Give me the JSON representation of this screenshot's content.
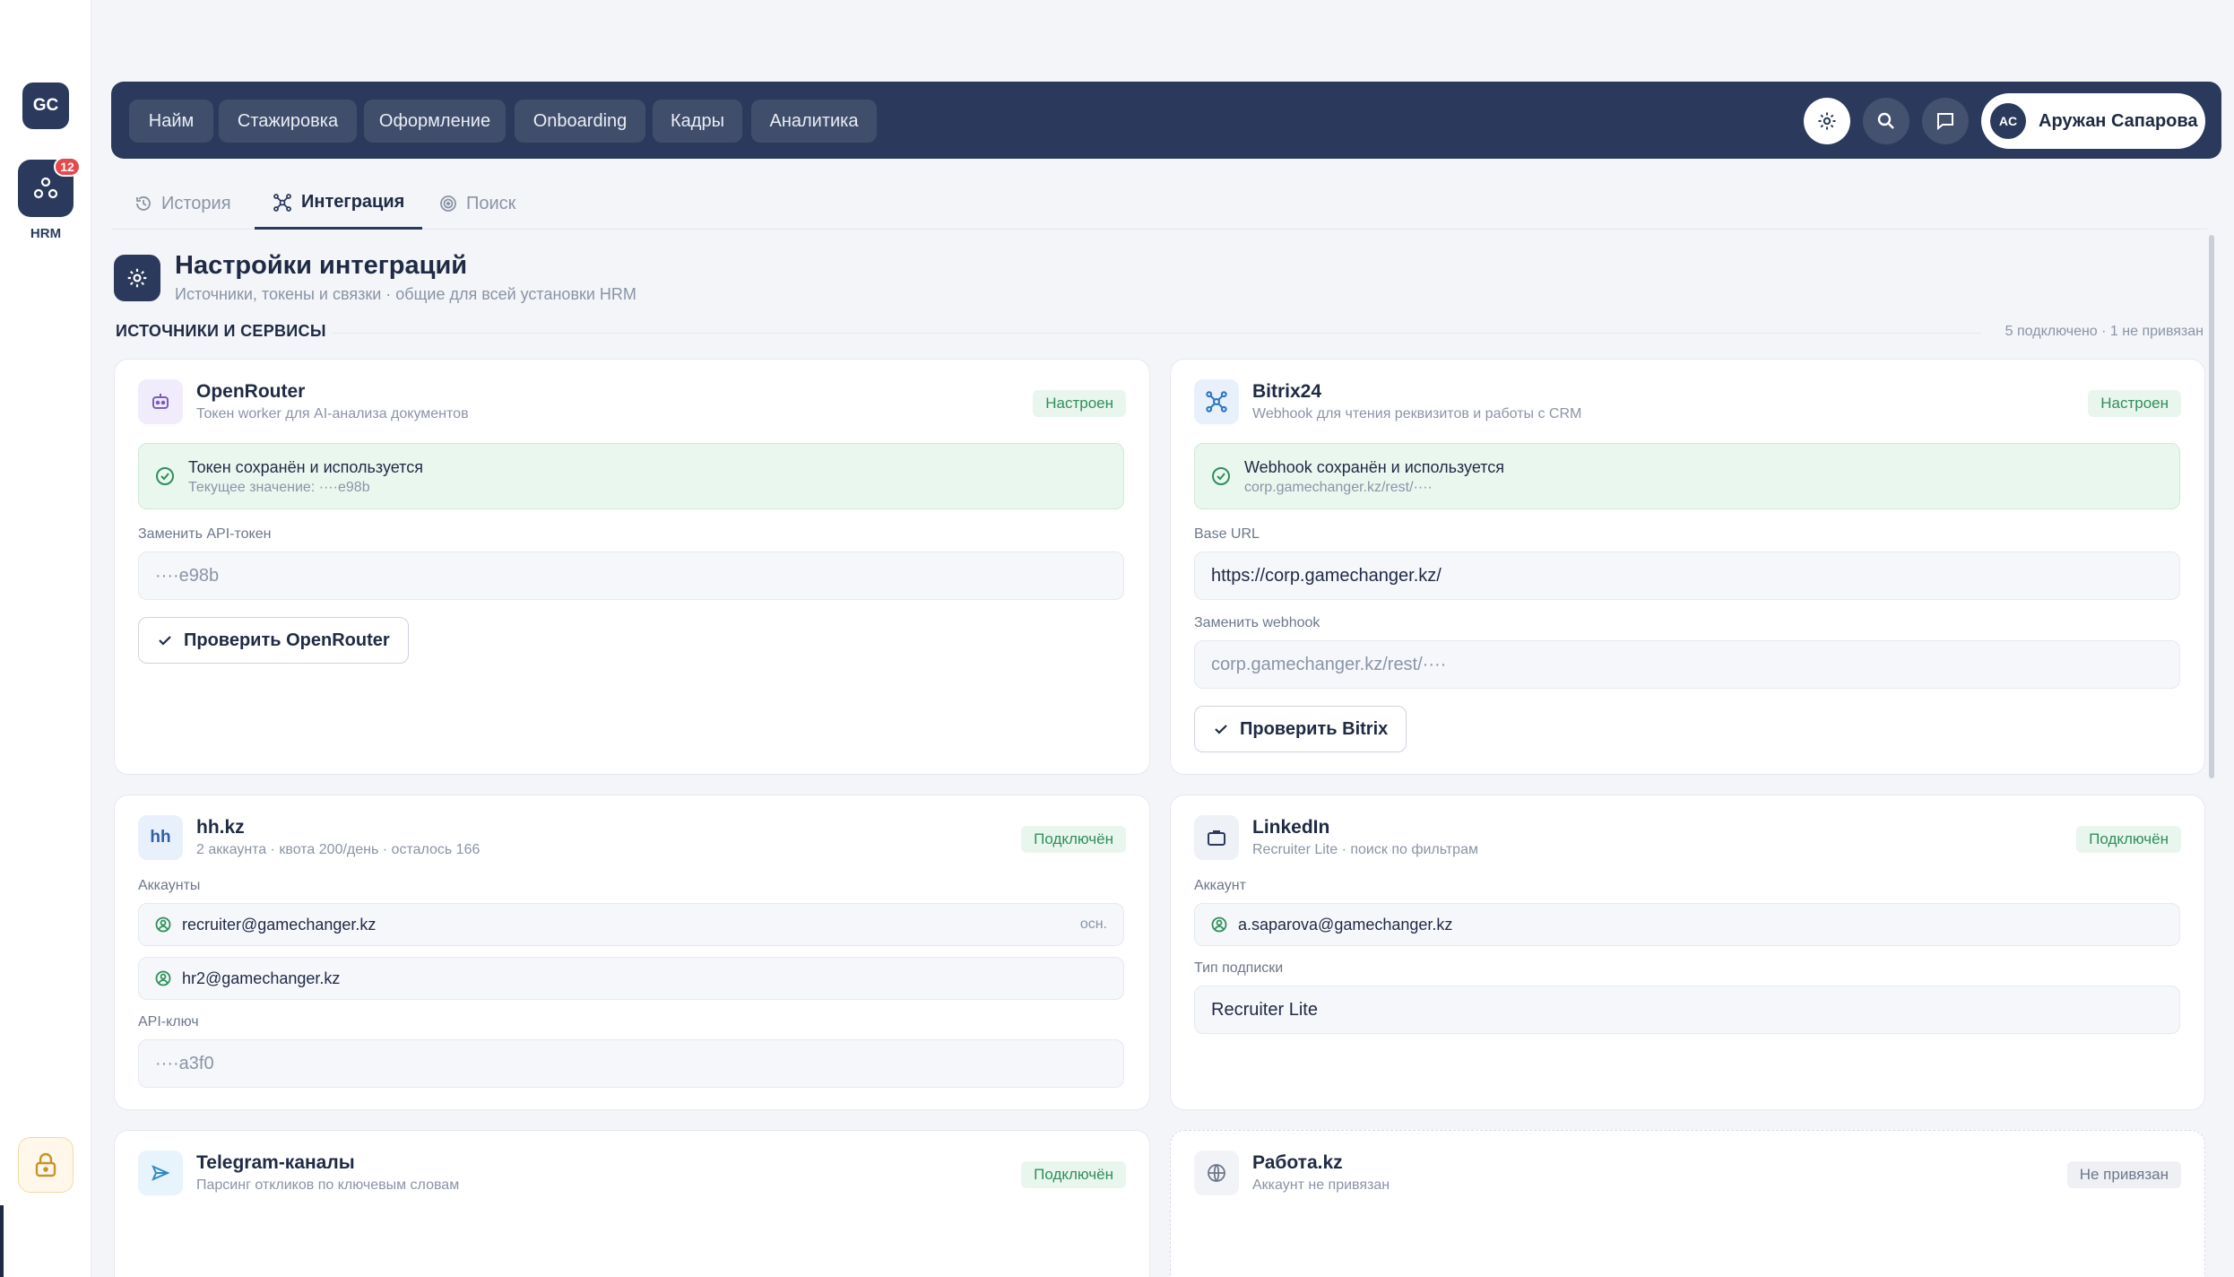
{
  "rail": {
    "logo": "GC",
    "app_badge": "12",
    "app_label": "HRM"
  },
  "topnav": {
    "items": [
      "Найм",
      "Стажировка",
      "Оформление",
      "Onboarding",
      "Кадры",
      "Аналитика"
    ],
    "user_initials": "AC",
    "user_name": "Аружан Сапарова"
  },
  "tabs": [
    "История",
    "Интеграция",
    "Поиск"
  ],
  "header": {
    "title": "Настройки интеграций",
    "subtitle": "Источники, токены и связки · общие для всей установки HRM"
  },
  "section": {
    "label": "ИСТОЧНИКИ И СЕРВИСЫ",
    "count": "5 подключено · 1 не привязан"
  },
  "cards": {
    "openrouter": {
      "title": "OpenRouter",
      "subtitle": "Токен worker для AI-анализа документов",
      "badge": "Настроен",
      "ok_title": "Токен сохранён и используется",
      "ok_sub": "Текущее значение: ····e98b",
      "field_label": "Заменить API-токен",
      "field_value": "····e98b",
      "button": "Проверить OpenRouter"
    },
    "bitrix": {
      "title": "Bitrix24",
      "subtitle": "Webhook для чтения реквизитов и работы с CRM",
      "badge": "Настроен",
      "ok_title": "Webhook сохранён и используется",
      "ok_sub": "corp.gamechanger.kz/rest/····",
      "url_label": "Base URL",
      "url_value": "https://corp.gamechanger.kz/",
      "webhook_label": "Заменить webhook",
      "webhook_value": "corp.gamechanger.kz/rest/····",
      "button": "Проверить Bitrix"
    },
    "hh": {
      "icon_text": "hh",
      "title": "hh.kz",
      "subtitle": "2 аккаунта · квота 200/день · осталось 166",
      "badge": "Подключён",
      "accounts_label": "Аккаунты",
      "accounts": [
        "recruiter@gamechanger.kz",
        "hr2@gamechanger.kz"
      ],
      "primary_tag": "осн.",
      "api_label": "API-ключ",
      "api_value": "····a3f0"
    },
    "linkedin": {
      "title": "LinkedIn",
      "subtitle": "Recruiter Lite · поиск по фильтрам",
      "badge": "Подключён",
      "account_label": "Аккаунт",
      "account_value": "a.saparova@gamechanger.kz",
      "plan_label": "Тип подписки",
      "plan_value": "Recruiter Lite"
    },
    "telegram": {
      "title": "Telegram-каналы",
      "subtitle": "Парсинг откликов по ключевым словам",
      "badge": "Подключён"
    },
    "rabota": {
      "title": "Работа.kz",
      "subtitle": "Аккаунт не привязан",
      "badge": "Не привязан"
    }
  },
  "colors": {
    "navy": "#2b3a5c",
    "success_bg": "#eaf7ef",
    "success_text": "#2f8f5b",
    "badge_red": "#e5484d"
  }
}
